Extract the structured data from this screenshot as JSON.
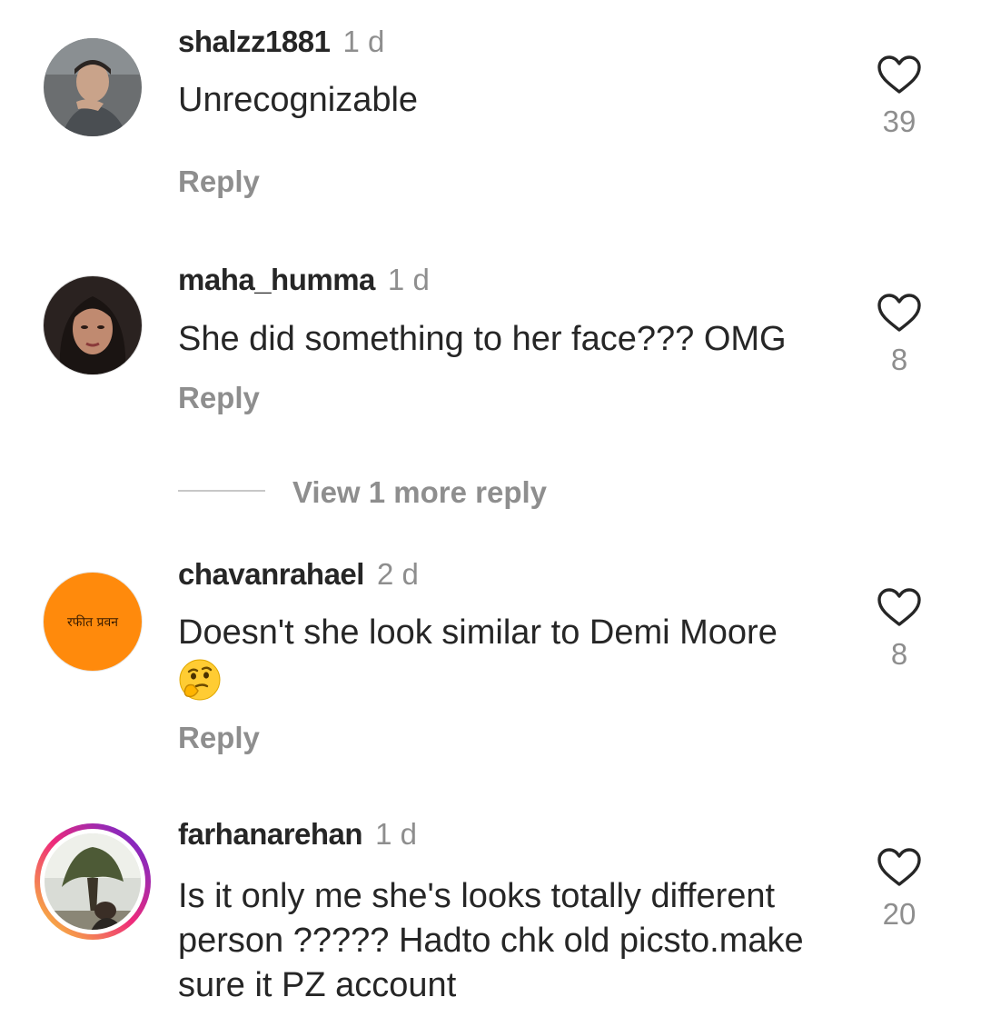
{
  "comments": [
    {
      "username": "shalzz1881",
      "time": "1 d",
      "text": "Unrecognizable",
      "reply_label": "Reply",
      "likes": "39",
      "like_icon": "heart-outline-icon",
      "avatar": "photo"
    },
    {
      "username": "maha_humma",
      "time": "1 d",
      "text": "She did something to her face??? OMG",
      "reply_label": "Reply",
      "likes": "8",
      "like_icon": "heart-outline-icon",
      "avatar": "photo"
    },
    {
      "username": "chavanrahael",
      "time": "2 d",
      "text": "Doesn't she look similar to Demi Moore",
      "emoji": "thinking-face-emoji",
      "reply_label": "Reply",
      "likes": "8",
      "like_icon": "heart-outline-icon",
      "avatar": "orange-logo",
      "avatar_color": "#ff8a0c",
      "avatar_text": "रफीत प्रवन"
    },
    {
      "username": "farhanarehan",
      "time": "1 d",
      "text": "Is it only me she's looks totally different person ????? Hadto chk old picsto.make sure it PZ account",
      "likes": "20",
      "like_icon": "heart-outline-icon",
      "avatar": "photo-story-ring"
    }
  ],
  "view_more_replies": "View 1 more reply",
  "colors": {
    "primary_text": "#262626",
    "secondary_text": "#8e8e8e",
    "divider": "#c7c7c7",
    "story_ring_start": "#f9ce34",
    "story_ring_mid": "#ee2a7b",
    "story_ring_end": "#6228d7"
  }
}
